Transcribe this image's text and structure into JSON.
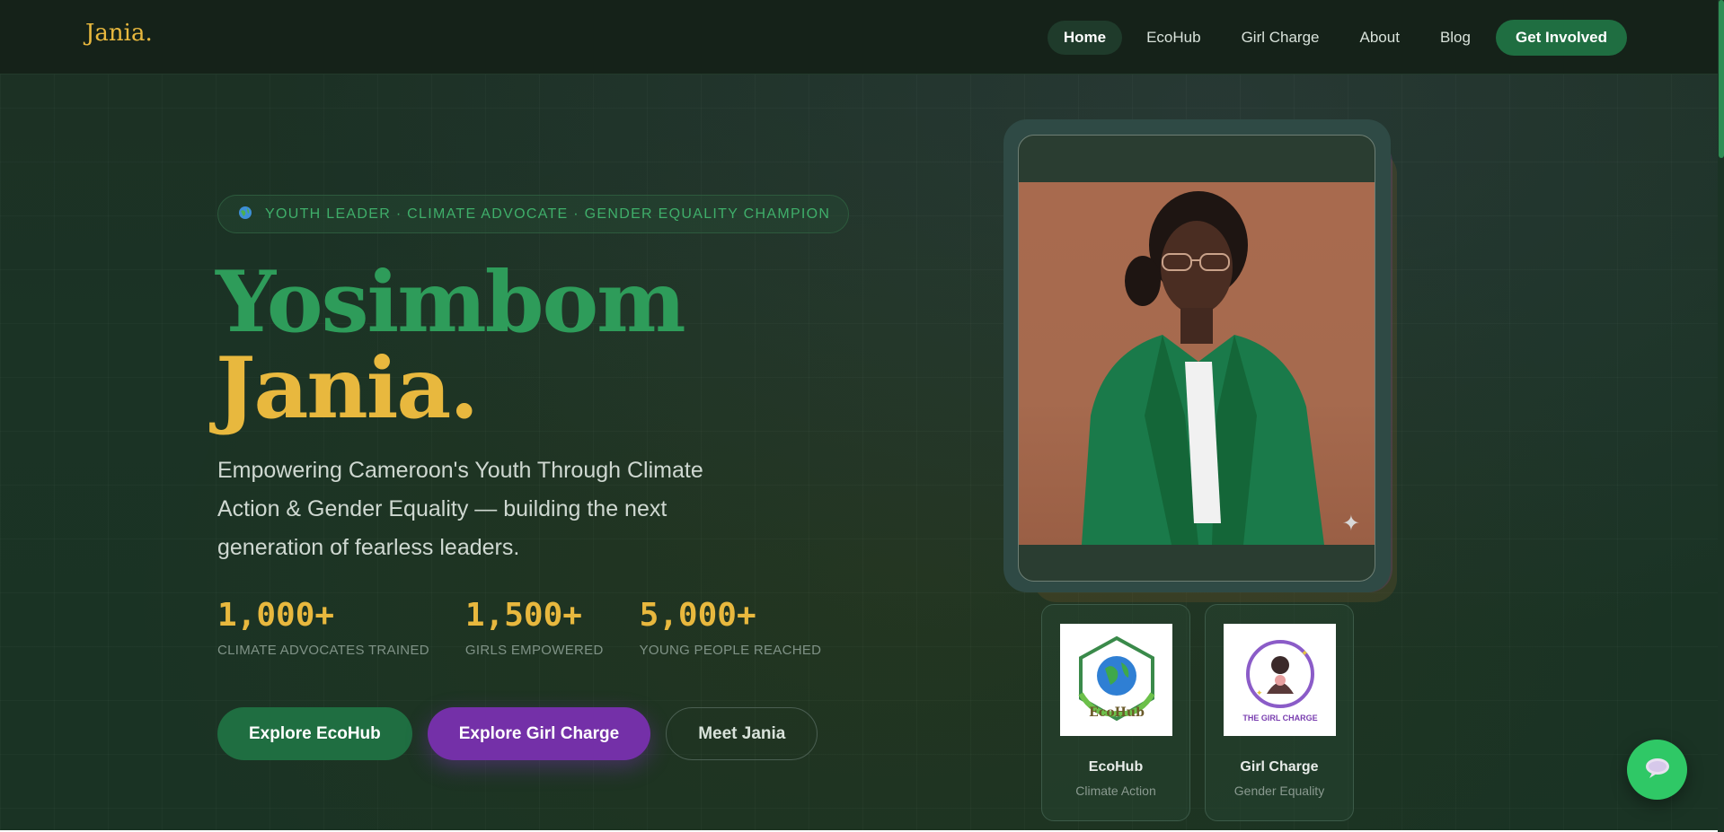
{
  "nav": {
    "logo": "Jania",
    "logo_dot": ".",
    "links": [
      "Home",
      "EcoHub",
      "Girl Charge",
      "About",
      "Blog"
    ],
    "cta": "Get Involved"
  },
  "hero": {
    "tagline": "YOUTH LEADER · CLIMATE ADVOCATE · GENDER EQUALITY CHAMPION",
    "name_first": "Yosimbom",
    "name_last": "Jania.",
    "subtitle": "Empowering Cameroon's Youth Through Climate Action & Gender Equality — building the next generation of fearless leaders.",
    "stats": [
      {
        "value": "1,000+",
        "label": "CLIMATE ADVOCATES TRAINED"
      },
      {
        "value": "1,500+",
        "label": "GIRLS EMPOWERED"
      },
      {
        "value": "5,000+",
        "label": "YOUNG PEOPLE REACHED"
      }
    ],
    "buttons": {
      "ecohub": "Explore EcoHub",
      "girl_charge": "Explore Girl Charge",
      "meet": "Meet Jania"
    }
  },
  "programs": [
    {
      "title": "EcoHub",
      "subtitle": "Climate Action",
      "logo_text": "EcoHub"
    },
    {
      "title": "Girl Charge",
      "subtitle": "Gender Equality",
      "logo_text": "THE GIRL CHARGE"
    }
  ],
  "icons": {
    "tagline": "globe-icon",
    "photo_corner": "sparkle-icon",
    "chat": "chat-bubble-icon"
  },
  "colors": {
    "brand_green": "#1f6e41",
    "accent_gold": "#e8b83e",
    "name_green": "#2e9c5a",
    "purple": "#7430a8",
    "chat_green": "#2fc866"
  }
}
